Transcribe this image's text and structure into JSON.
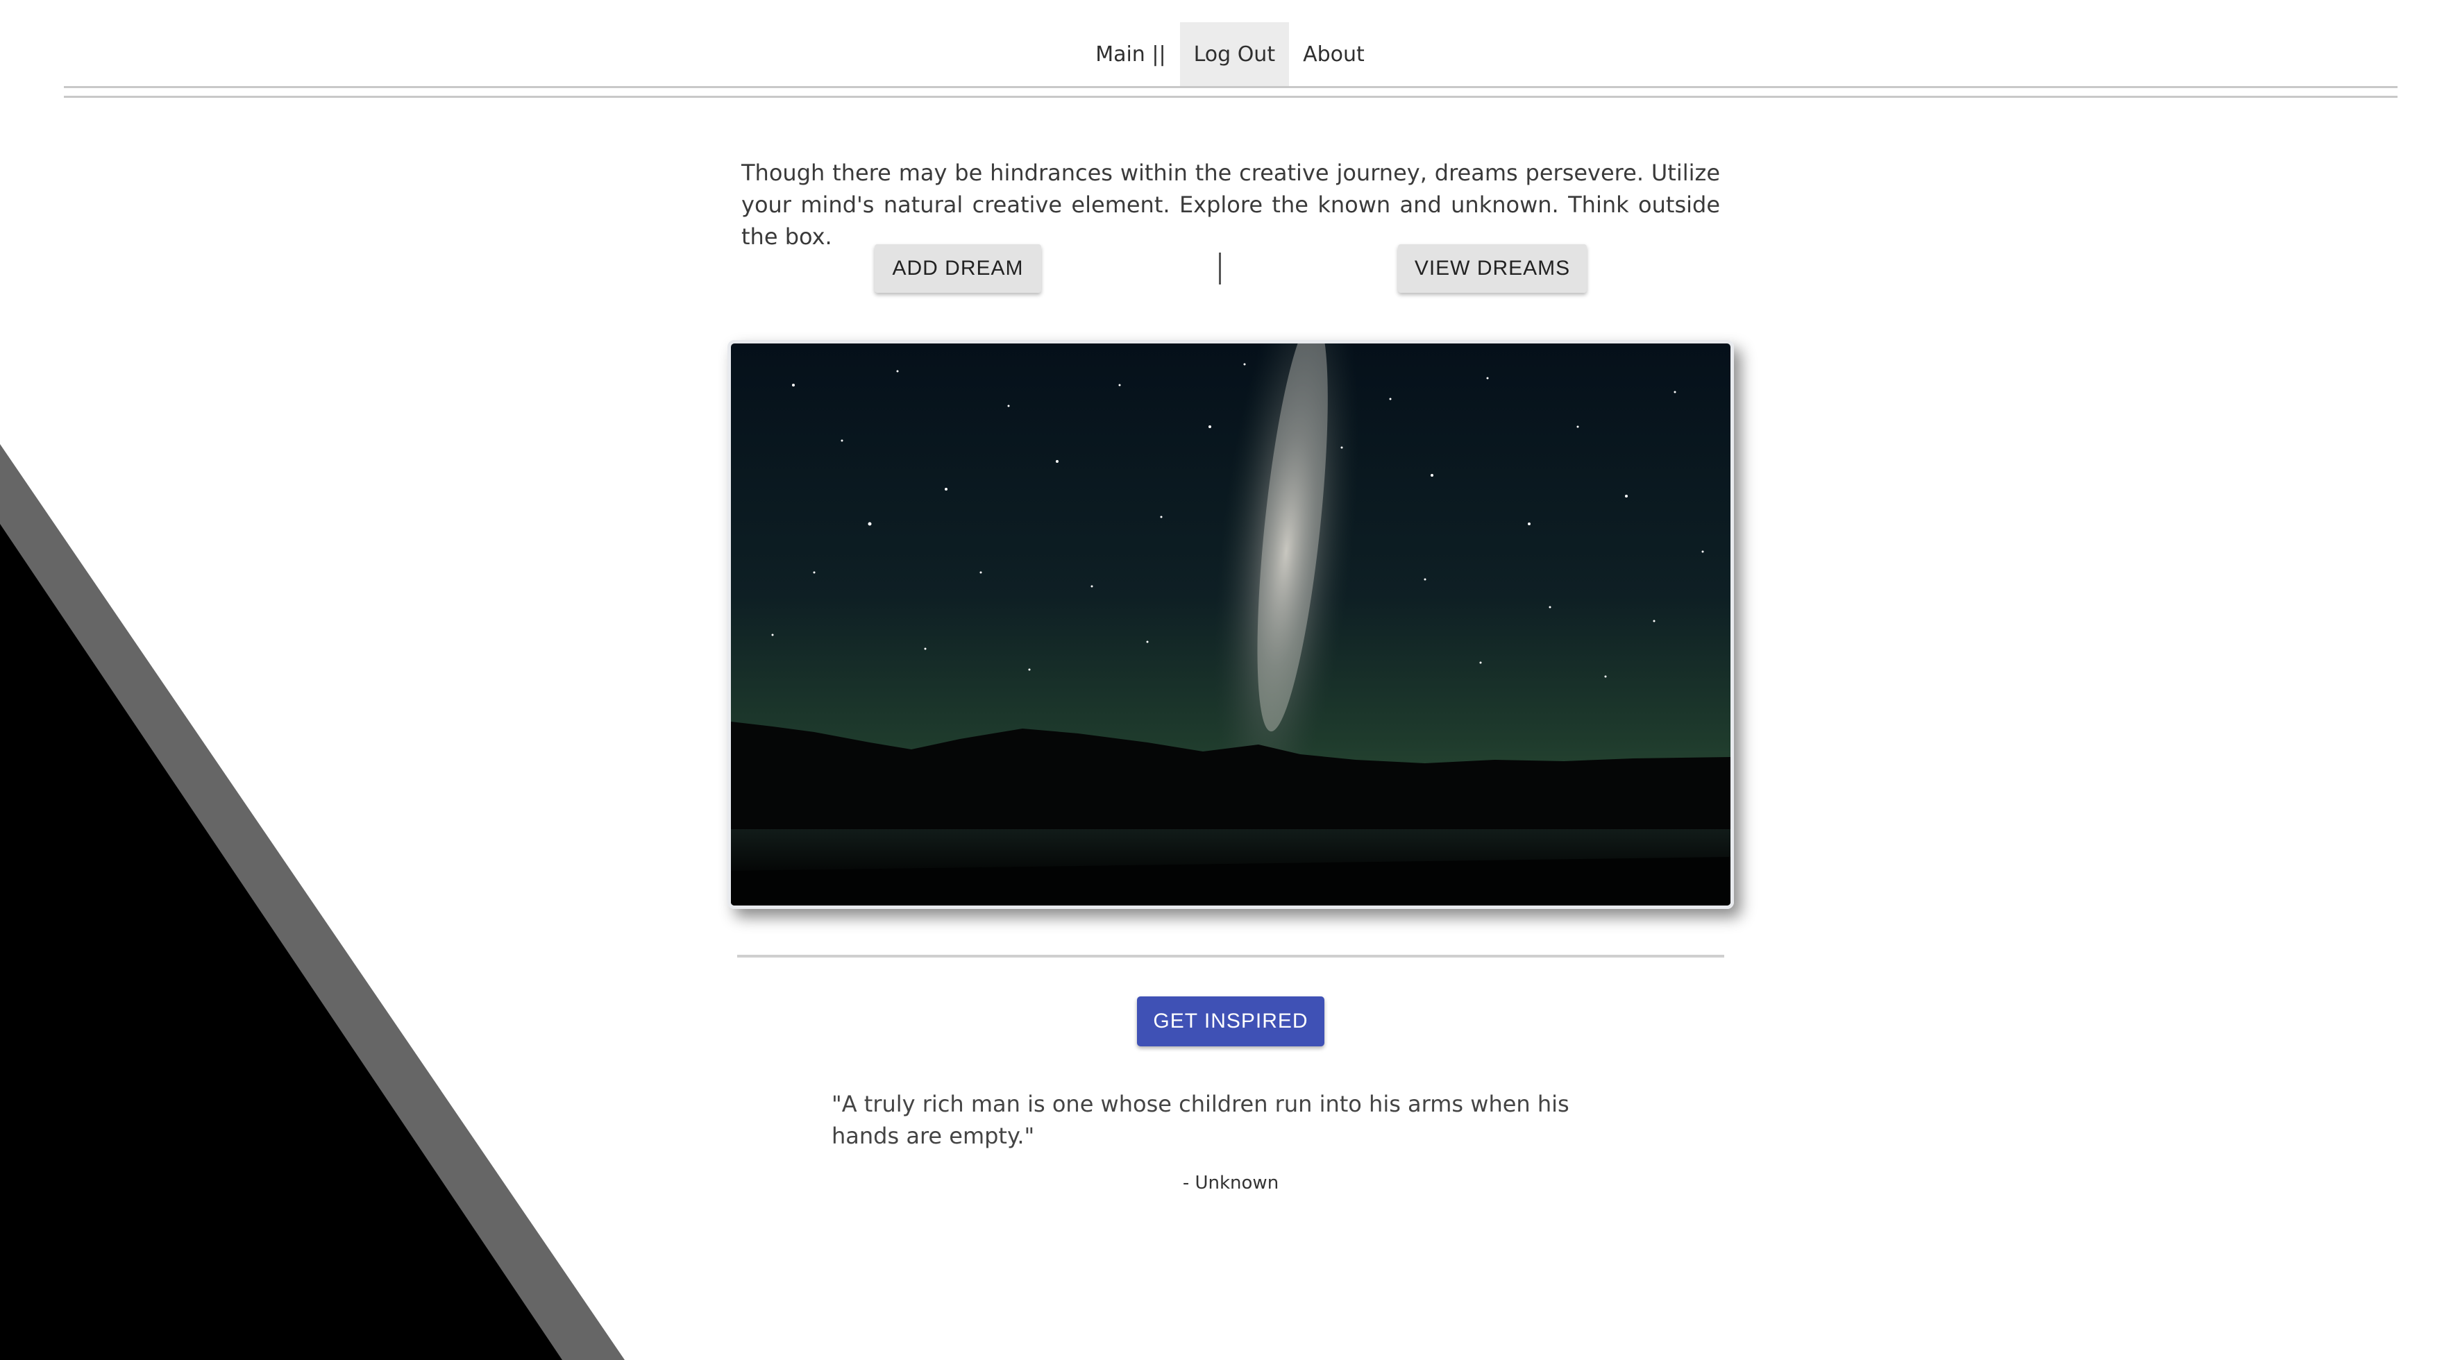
{
  "nav": {
    "items": [
      {
        "label": "Main ||",
        "active": false
      },
      {
        "label": "Log Out",
        "active": true
      },
      {
        "label": "About",
        "active": false
      }
    ]
  },
  "intro": {
    "text": "Though there may be hindrances within the creative journey, dreams persevere. Utilize your mind's natural creative element. Explore the known and unknown. Think outside the box."
  },
  "actions": {
    "add_dream_label": "ADD DREAM",
    "view_dreams_label": "VIEW DREAMS"
  },
  "hero": {
    "subject": "night-sky-milky-way-image"
  },
  "inspire": {
    "button_label": "GET INSPIRED",
    "quote": "\"A truly rich man is one whose children run into his arms when his hands are empty.\"",
    "author": "- Unknown"
  },
  "colors": {
    "accent": "#3f51b5",
    "button_gray": "#e3e3e3",
    "nav_active": "#ececec",
    "decor_black": "#000000",
    "decor_gray": "#666666"
  }
}
